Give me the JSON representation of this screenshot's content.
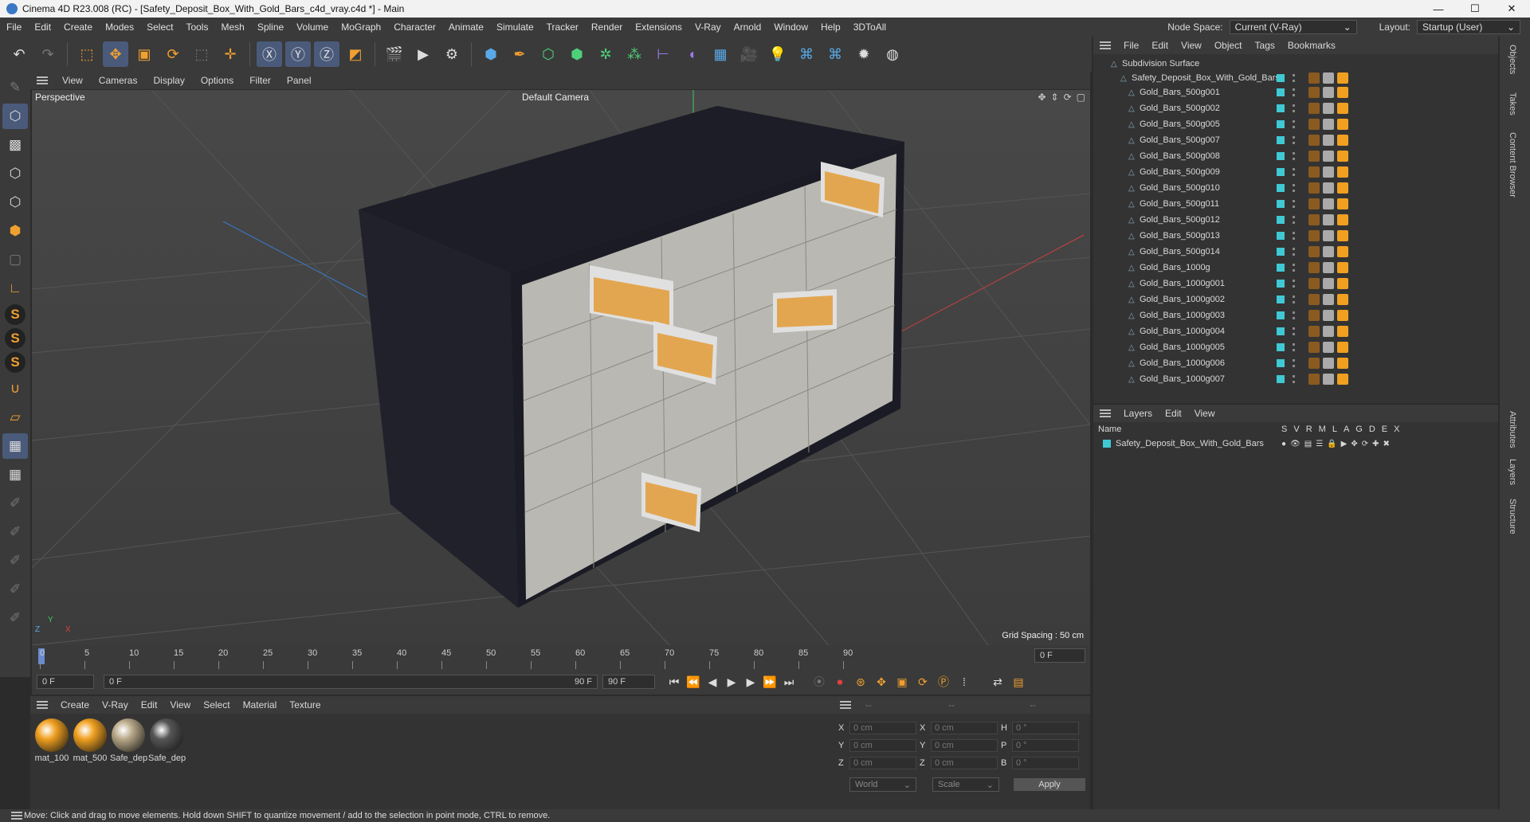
{
  "window": {
    "title": "Cinema 4D R23.008 (RC) - [Safety_Deposit_Box_With_Gold_Bars_c4d_vray.c4d *] - Main",
    "minimize": "—",
    "maximize": "☐",
    "close": "✕"
  },
  "menu": [
    "File",
    "Edit",
    "Create",
    "Modes",
    "Select",
    "Tools",
    "Mesh",
    "Spline",
    "Volume",
    "MoGraph",
    "Character",
    "Animate",
    "Simulate",
    "Tracker",
    "Render",
    "Extensions",
    "V-Ray",
    "Arnold",
    "Window",
    "Help",
    "3DToAll"
  ],
  "nodespace": {
    "label": "Node Space:",
    "value": "Current (V-Ray)",
    "layout_label": "Layout:",
    "layout_value": "Startup (User)"
  },
  "viewport": {
    "menu": [
      "View",
      "Cameras",
      "Display",
      "Options",
      "Filter",
      "Panel"
    ],
    "projection": "Perspective",
    "camera": "Default Camera",
    "grid": "Grid Spacing : 50 cm"
  },
  "timeline": {
    "ticks": [
      "0",
      "5",
      "10",
      "15",
      "20",
      "25",
      "30",
      "35",
      "40",
      "45",
      "50",
      "55",
      "60",
      "65",
      "70",
      "75",
      "80",
      "85",
      "90"
    ],
    "current": "0 F"
  },
  "transport": {
    "start": "0 F",
    "range_start": "0 F",
    "range_end": "90 F",
    "end": "90 F"
  },
  "materials": {
    "menu": [
      "Create",
      "V-Ray",
      "Edit",
      "View",
      "Select",
      "Material",
      "Texture"
    ],
    "items": [
      {
        "label": "mat_100",
        "color": "#f0a020"
      },
      {
        "label": "mat_500",
        "color": "#f0a020"
      },
      {
        "label": "Safe_dep",
        "color": "#b8a888"
      },
      {
        "label": "Safe_dep",
        "color": "#555555"
      }
    ]
  },
  "coords": {
    "headers": [
      "--",
      "--",
      "--"
    ],
    "x": "0 cm",
    "y": "0 cm",
    "z": "0 cm",
    "sx": "0 cm",
    "sy": "0 cm",
    "sz": "0 cm",
    "h": "0 °",
    "p": "0 °",
    "b": "0 °",
    "labels": {
      "x": "X",
      "y": "Y",
      "z": "Z",
      "h": "H",
      "p": "P",
      "b": "B"
    },
    "world": "World",
    "scale": "Scale",
    "apply": "Apply"
  },
  "status": "Move: Click and drag to move elements. Hold down SHIFT to quantize movement / add to the selection in point mode, CTRL to remove.",
  "objects": {
    "menu": [
      "File",
      "Edit",
      "View",
      "Object",
      "Tags",
      "Bookmarks"
    ],
    "root": "Subdivision Surface",
    "group": "Safety_Deposit_Box_With_Gold_Bars",
    "items": [
      "Gold_Bars_500g001",
      "Gold_Bars_500g002",
      "Gold_Bars_500g005",
      "Gold_Bars_500g007",
      "Gold_Bars_500g008",
      "Gold_Bars_500g009",
      "Gold_Bars_500g010",
      "Gold_Bars_500g011",
      "Gold_Bars_500g012",
      "Gold_Bars_500g013",
      "Gold_Bars_500g014",
      "Gold_Bars_1000g",
      "Gold_Bars_1000g001",
      "Gold_Bars_1000g002",
      "Gold_Bars_1000g003",
      "Gold_Bars_1000g004",
      "Gold_Bars_1000g005",
      "Gold_Bars_1000g006",
      "Gold_Bars_1000g007"
    ]
  },
  "layers": {
    "menu": [
      "Layers",
      "Edit",
      "View"
    ],
    "col_name": "Name",
    "cols": [
      "S",
      "V",
      "R",
      "M",
      "L",
      "A",
      "G",
      "D",
      "E",
      "X"
    ],
    "item": "Safety_Deposit_Box_With_Gold_Bars"
  },
  "sidetabs": [
    "Objects",
    "Takes",
    "Content Browser",
    "Attributes",
    "Layers",
    "Structure"
  ],
  "colors": {
    "accent": "#4a5a7a",
    "teal": "#3fc9d4",
    "gold": "#f0a020"
  }
}
